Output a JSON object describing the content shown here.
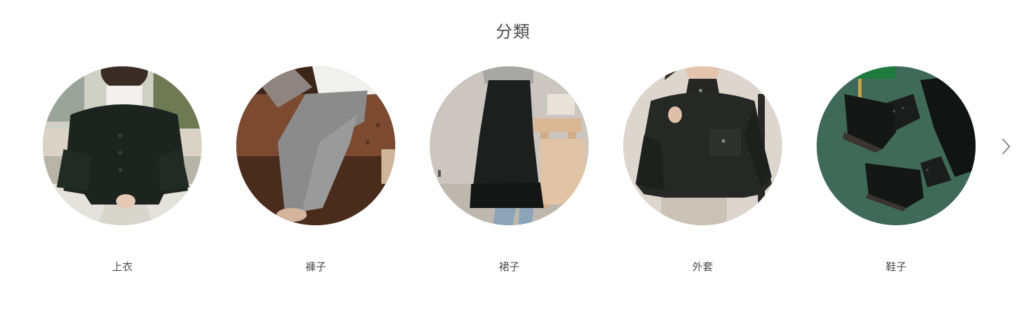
{
  "section": {
    "title": "分類"
  },
  "categories": [
    {
      "label": "上衣",
      "image_icon": "cardigan-photo-icon"
    },
    {
      "label": "褲子",
      "image_icon": "pants-photo-icon"
    },
    {
      "label": "裙子",
      "image_icon": "skirt-photo-icon"
    },
    {
      "label": "外套",
      "image_icon": "jacket-photo-icon"
    },
    {
      "label": "鞋子",
      "image_icon": "shoes-photo-icon"
    }
  ],
  "navigation": {
    "next_icon": "chevron-right-icon"
  }
}
